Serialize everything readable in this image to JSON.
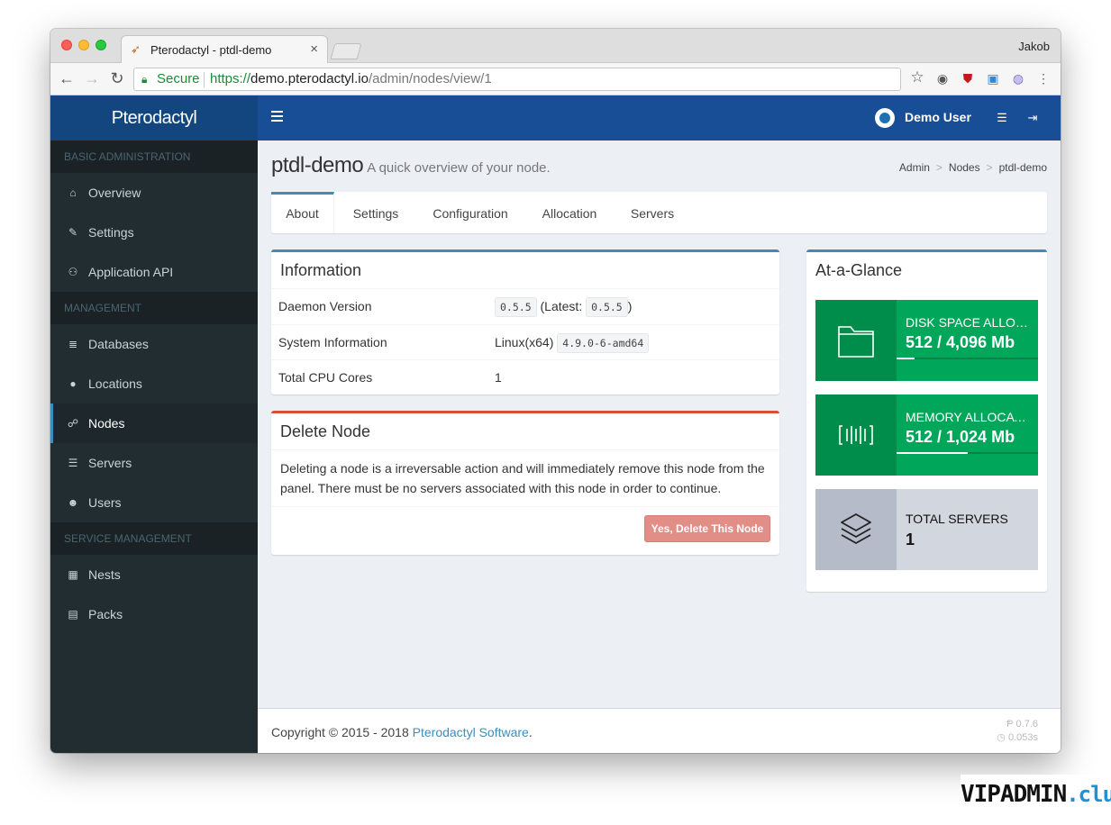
{
  "browser": {
    "tab_title": "Pterodactyl - ptdl-demo",
    "profile": "Jakob",
    "secure_label": "Secure",
    "url_scheme": "https://",
    "url_host": "demo.pterodactyl.io",
    "url_path": "/admin/nodes/view/1"
  },
  "header": {
    "logo": "Pterodactyl",
    "user_name": "Demo User"
  },
  "sidebar": {
    "sections": [
      {
        "header": "BASIC ADMINISTRATION",
        "items": [
          {
            "label": "Overview",
            "icon": "home-icon"
          },
          {
            "label": "Settings",
            "icon": "wrench-icon"
          },
          {
            "label": "Application API",
            "icon": "gamepad-icon"
          }
        ]
      },
      {
        "header": "MANAGEMENT",
        "items": [
          {
            "label": "Databases",
            "icon": "database-icon"
          },
          {
            "label": "Locations",
            "icon": "globe-icon"
          },
          {
            "label": "Nodes",
            "icon": "sitemap-icon",
            "active": true
          },
          {
            "label": "Servers",
            "icon": "server-icon"
          },
          {
            "label": "Users",
            "icon": "users-icon"
          }
        ]
      },
      {
        "header": "SERVICE MANAGEMENT",
        "items": [
          {
            "label": "Nests",
            "icon": "th-large-icon"
          },
          {
            "label": "Packs",
            "icon": "archive-icon"
          }
        ]
      }
    ]
  },
  "page": {
    "title": "ptdl-demo",
    "subtitle": "A quick overview of your node.",
    "breadcrumb": [
      "Admin",
      "Nodes",
      "ptdl-demo"
    ],
    "tabs": [
      "About",
      "Settings",
      "Configuration",
      "Allocation",
      "Servers"
    ],
    "active_tab": "About"
  },
  "information": {
    "title": "Information",
    "daemon_label": "Daemon Version",
    "daemon_version": "0.5.5",
    "latest_prefix": "(Latest:",
    "latest_version": "0.5.5",
    "latest_suffix": ")",
    "system_label": "System Information",
    "system_os": "Linux(x64)",
    "system_kernel": "4.9.0-6-amd64",
    "cpu_label": "Total CPU Cores",
    "cpu_value": "1"
  },
  "delete_node": {
    "title": "Delete Node",
    "text": "Deleting a node is a irreversable action and will immediately remove this node from the panel. There must be no servers associated with this node in order to continue.",
    "button": "Yes, Delete This Node"
  },
  "glance": {
    "title": "At-a-Glance",
    "disk": {
      "label": "DISK SPACE ALLOCATED",
      "value": "512 / 4,096 Mb",
      "progress": 0.125,
      "icon": "folder-icon"
    },
    "memory": {
      "label": "MEMORY ALLOCATED",
      "value": "512 / 1,024 Mb",
      "progress": 0.5,
      "icon": "barcode-icon"
    },
    "servers": {
      "label": "TOTAL SERVERS",
      "value": "1",
      "icon": "layers-icon"
    }
  },
  "footer": {
    "copyright": "Copyright © 2015 - 2018",
    "link": "Pterodactyl Software",
    "period": ".",
    "version": "0.7.6",
    "time": "0.053s"
  },
  "watermark": {
    "main": "VIPADMIN",
    "suffix": ".club"
  },
  "colors": {
    "topbar": "#174e96",
    "sidebar": "#222d32",
    "primary": "#3c8dbc",
    "danger": "#dd4b39",
    "success": "#00a65a"
  }
}
